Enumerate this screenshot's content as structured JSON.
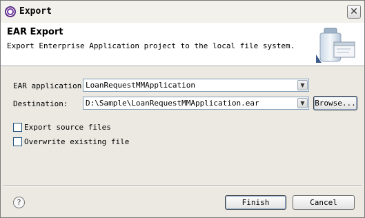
{
  "window": {
    "title": "Export"
  },
  "banner": {
    "title": "EAR Export",
    "description": "Export Enterprise Application project to the local file system."
  },
  "form": {
    "ear_application": {
      "label": "EAR application:",
      "value": "LoanRequestMMApplication"
    },
    "destination": {
      "label": "Destination:",
      "value": "D:\\Sample\\LoanRequestMMApplication.ear"
    },
    "browse_label": "Browse...",
    "export_source_files": {
      "label": "Export source files",
      "checked": false
    },
    "overwrite_existing": {
      "label": "Overwrite existing file",
      "checked": false
    }
  },
  "footer": {
    "finish_label": "Finish",
    "cancel_label": "Cancel"
  },
  "icons": {
    "app": "eclipse-icon",
    "close": "close-icon",
    "banner": "jar-export-icon",
    "help": "help-icon",
    "dropdown": "chevron-down-icon"
  }
}
